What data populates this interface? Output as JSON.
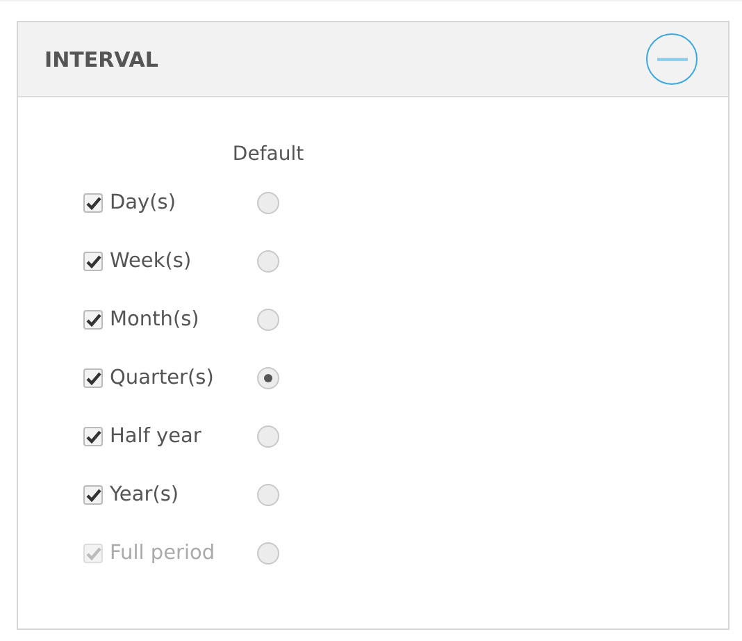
{
  "panel": {
    "title": "INTERVAL",
    "expanded": true
  },
  "default_column": "Default",
  "intervals": [
    {
      "label": "Day(s)",
      "checked": true,
      "disabled": false,
      "selected": false
    },
    {
      "label": "Week(s)",
      "checked": true,
      "disabled": false,
      "selected": false
    },
    {
      "label": "Month(s)",
      "checked": true,
      "disabled": false,
      "selected": false
    },
    {
      "label": "Quarter(s)",
      "checked": true,
      "disabled": false,
      "selected": true
    },
    {
      "label": "Half year",
      "checked": true,
      "disabled": false,
      "selected": false
    },
    {
      "label": "Year(s)",
      "checked": true,
      "disabled": false,
      "selected": false
    },
    {
      "label": "Full period",
      "checked": true,
      "disabled": true,
      "selected": false
    }
  ]
}
